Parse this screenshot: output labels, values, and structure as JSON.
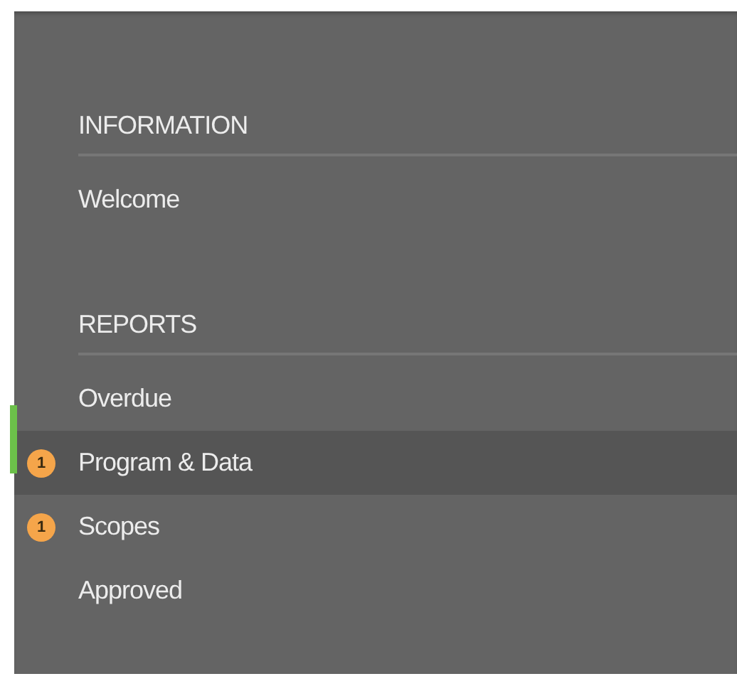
{
  "sections": [
    {
      "heading": "INFORMATION",
      "items": [
        {
          "label": "Welcome",
          "selected": false
        }
      ]
    },
    {
      "heading": "REPORTS",
      "items": [
        {
          "label": "Overdue",
          "selected": false
        },
        {
          "label": "Program & Data",
          "selected": true,
          "badge": "1"
        },
        {
          "label": "Scopes",
          "selected": false,
          "badge": "1"
        },
        {
          "label": "Approved",
          "selected": false
        }
      ]
    }
  ]
}
